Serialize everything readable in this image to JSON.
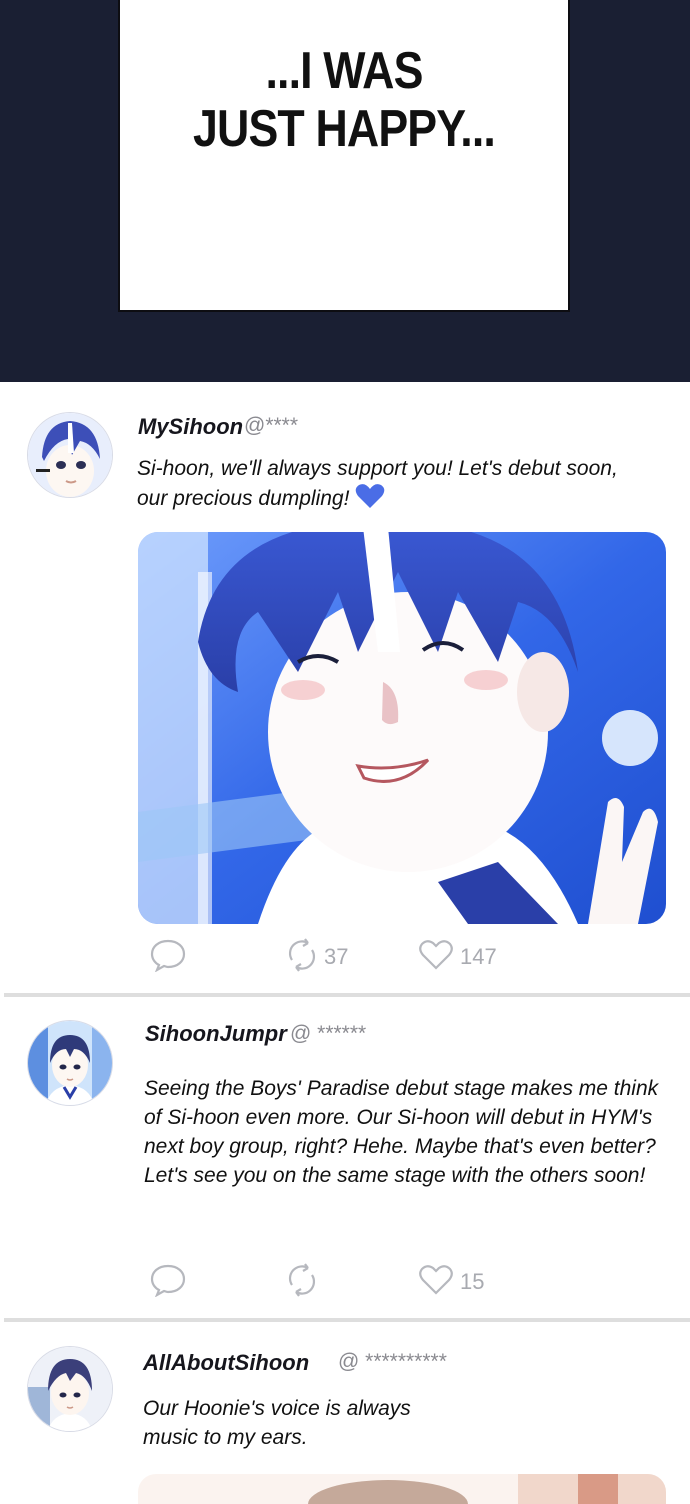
{
  "caption": {
    "line1": "...I WAS",
    "line2": "JUST HAPPY..."
  },
  "posts": [
    {
      "username": "MySihoon",
      "handle": "@****",
      "text_line1": "Si-hoon, we'll always support you! Let's debut soon,",
      "text_line2": "our precious dumpling!",
      "retweets": "37",
      "likes": "147"
    },
    {
      "username": "SihoonJumpr",
      "handle": "@ ******",
      "text": "Seeing the Boys' Paradise debut stage makes me think of Si-hoon even more. Our Si-hoon will debut in HYM's next boy group, right? Hehe. Maybe that's even better? Let's see you on the same stage with the others soon!",
      "likes": "15"
    },
    {
      "username": "AllAboutSihoon",
      "handle": "@ **********",
      "text": "Our Hoonie's voice is always music to my ears."
    }
  ],
  "colors": {
    "panel": "#1a1f33",
    "heart_emoji": "#4a6de6",
    "icon_gray": "#a8aab0"
  }
}
